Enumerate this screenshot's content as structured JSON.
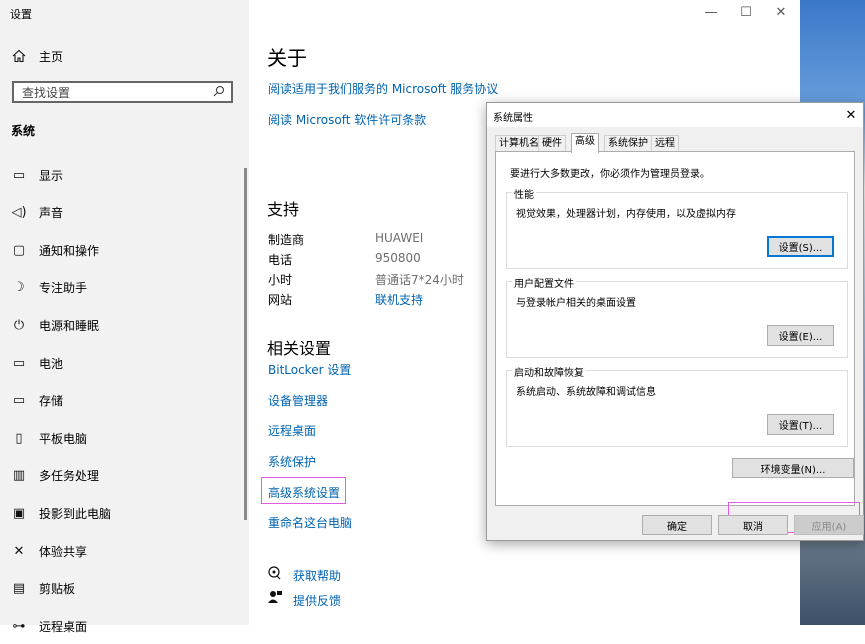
{
  "window": {
    "title": "设置",
    "controls": {
      "minimize": "—",
      "maximize": "☐",
      "close": "✕"
    }
  },
  "sidebar": {
    "home_label": "主页",
    "search_placeholder": "查找设置",
    "section_label": "系统",
    "items": [
      {
        "label": "显示",
        "icon": "display-icon"
      },
      {
        "label": "声音",
        "icon": "speaker-icon"
      },
      {
        "label": "通知和操作",
        "icon": "notification-icon"
      },
      {
        "label": "专注助手",
        "icon": "moon-icon"
      },
      {
        "label": "电源和睡眠",
        "icon": "power-icon"
      },
      {
        "label": "电池",
        "icon": "battery-icon"
      },
      {
        "label": "存储",
        "icon": "storage-icon"
      },
      {
        "label": "平板电脑",
        "icon": "tablet-icon"
      },
      {
        "label": "多任务处理",
        "icon": "multitask-icon"
      },
      {
        "label": "投影到此电脑",
        "icon": "project-icon"
      },
      {
        "label": "体验共享",
        "icon": "share-icon"
      },
      {
        "label": "剪贴板",
        "icon": "clipboard-icon"
      },
      {
        "label": "远程桌面",
        "icon": "remote-desktop-icon"
      }
    ]
  },
  "main": {
    "about_title": "关于",
    "links_top": [
      "阅读适用于我们服务的 Microsoft 服务协议",
      "阅读 Microsoft 软件许可条款"
    ],
    "support_title": "支持",
    "support_rows": [
      {
        "key": "制造商",
        "value": "HUAWEI",
        "is_link": false
      },
      {
        "key": "电话",
        "value": "950800",
        "is_link": false
      },
      {
        "key": "小时",
        "value": "普通话7*24小时",
        "is_link": false
      },
      {
        "key": "网站",
        "value": "联机支持",
        "is_link": true
      }
    ],
    "related_title": "相关设置",
    "related_links": [
      "BitLocker 设置",
      "设备管理器",
      "远程桌面",
      "系统保护",
      "高级系统设置",
      "重命名这台电脑"
    ],
    "help_links": [
      {
        "label": "获取帮助",
        "icon": "help-chat-icon"
      },
      {
        "label": "提供反馈",
        "icon": "feedback-icon"
      }
    ]
  },
  "dialog": {
    "title": "系统属性",
    "close": "✕",
    "tabs": [
      "计算机名",
      "硬件",
      "高级",
      "系统保护",
      "远程"
    ],
    "active_tab": "高级",
    "admin_note": "要进行大多数更改，你必须作为管理员登录。",
    "groups": [
      {
        "title": "性能",
        "desc": "视觉效果，处理器计划，内存使用，以及虚拟内存",
        "button": "设置(S)..."
      },
      {
        "title": "用户配置文件",
        "desc": "与登录帐户相关的桌面设置",
        "button": "设置(E)..."
      },
      {
        "title": "启动和故障恢复",
        "desc": "系统启动、系统故障和调试信息",
        "button": "设置(T)..."
      }
    ],
    "env_button": "环境变量(N)...",
    "ok": "确定",
    "cancel": "取消",
    "apply": "应用(A)"
  },
  "colors": {
    "link": "#0063b1",
    "highlight": "#e05ce0",
    "focus": "#0078d7"
  }
}
